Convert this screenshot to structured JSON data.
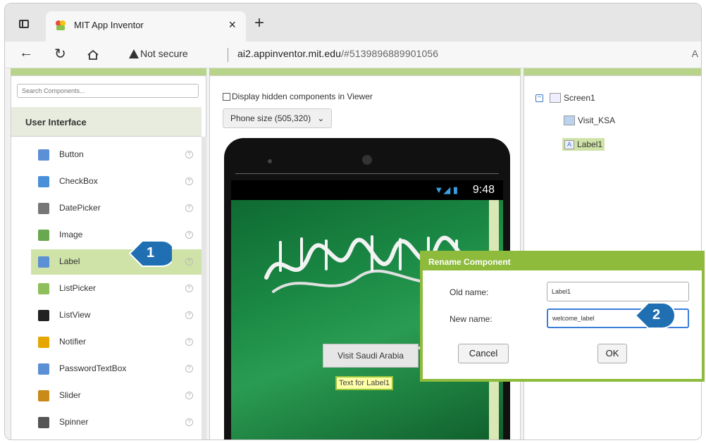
{
  "browser": {
    "tab_title": "MIT App Inventor",
    "tab_close": "×",
    "new_tab": "+",
    "not_secure": "Not secure",
    "url_host": "ai2.appinventor.mit.edu",
    "url_path": "/#5139896889901056",
    "reader_icon": "A"
  },
  "palette": {
    "search_placeholder": "Search Components...",
    "category": "User Interface",
    "items": [
      {
        "label": "Button",
        "icon": "button-icon",
        "color": "#5b8fd6"
      },
      {
        "label": "CheckBox",
        "icon": "checkbox-icon",
        "color": "#4a90d9"
      },
      {
        "label": "DatePicker",
        "icon": "datepicker-icon",
        "color": "#777777"
      },
      {
        "label": "Image",
        "icon": "image-icon",
        "color": "#6aa84f"
      },
      {
        "label": "Label",
        "icon": "label-icon",
        "color": "#5b8fd6"
      },
      {
        "label": "ListPicker",
        "icon": "listpicker-icon",
        "color": "#8fbf5a"
      },
      {
        "label": "ListView",
        "icon": "listview-icon",
        "color": "#222222"
      },
      {
        "label": "Notifier",
        "icon": "notifier-icon",
        "color": "#e6a600"
      },
      {
        "label": "PasswordTextBox",
        "icon": "password-icon",
        "color": "#5b8fd6"
      },
      {
        "label": "Slider",
        "icon": "slider-icon",
        "color": "#c98a1a"
      },
      {
        "label": "Spinner",
        "icon": "spinner-icon",
        "color": "#555555"
      }
    ],
    "help_glyph": "?"
  },
  "viewer": {
    "display_hidden": "Display hidden components in Viewer",
    "phone_size": "Phone size (505,320)",
    "status_time": "9:48",
    "status_icons": "▼◢ ▮",
    "button_text": "Visit Saudi Arabia",
    "label_text": "Text for Label1"
  },
  "tree": {
    "screen": "Screen1",
    "children": [
      "Visit_KSA",
      "Label1"
    ],
    "collapse": "−"
  },
  "dialog": {
    "title": "Rename Component",
    "old_label": "Old name:",
    "old_value": "Label1",
    "new_label": "New name:",
    "new_value": "welcome_label",
    "cancel": "Cancel",
    "ok": "OK"
  },
  "callouts": {
    "one": "1",
    "two": "2",
    "color": "#1f6fb2"
  },
  "colors": {
    "selection_green": "#cfe3a8",
    "dialog_green": "#8ebb3c"
  }
}
